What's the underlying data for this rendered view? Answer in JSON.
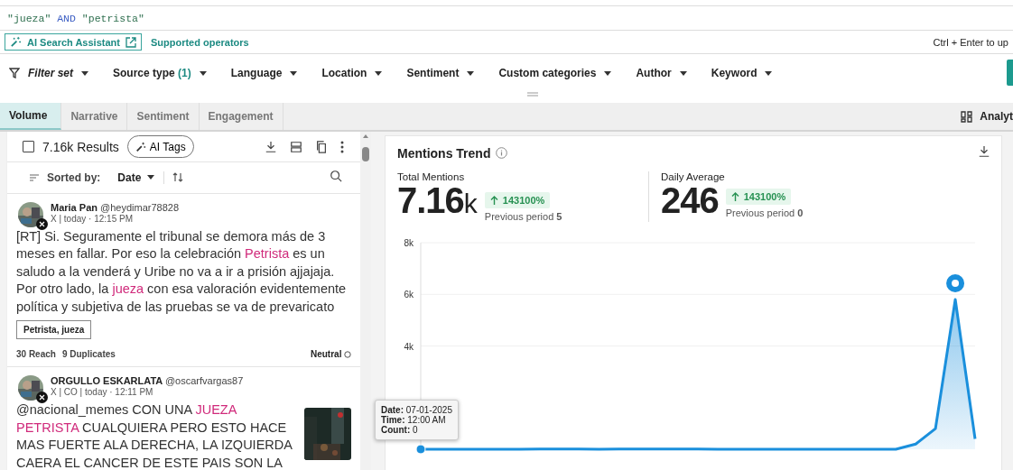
{
  "query": [
    {
      "text": "\"jueza\"",
      "kind": "term"
    },
    {
      "text": "AND",
      "kind": "operator"
    },
    {
      "text": "\"petrista\"",
      "kind": "term"
    }
  ],
  "assistant_button": "AI Search Assistant",
  "operators_link": "Supported operators",
  "shortcut_hint": "Ctrl + Enter to up",
  "filters": [
    {
      "label": "Filter set",
      "kind": "set"
    },
    {
      "label": "Source type",
      "count": "(1)",
      "kind": "filter"
    },
    {
      "label": "Language",
      "kind": "filter"
    },
    {
      "label": "Location",
      "kind": "filter"
    },
    {
      "label": "Sentiment",
      "kind": "filter"
    },
    {
      "label": "Custom categories",
      "kind": "filter"
    },
    {
      "label": "Author",
      "kind": "filter"
    },
    {
      "label": "Keyword",
      "kind": "filter"
    }
  ],
  "tabs": [
    {
      "label": "Volume",
      "selected": true
    },
    {
      "label": "Narrative",
      "selected": false
    },
    {
      "label": "Sentiment",
      "selected": false
    },
    {
      "label": "Engagement",
      "selected": false
    }
  ],
  "analytics_label": "Analyt",
  "results": {
    "count": "7.16k Results",
    "checked": false,
    "ai_tags": "AI Tags",
    "sort_label": "Sorted by:",
    "sort_value": "Date"
  },
  "posts": [
    {
      "name": "Maria Pan",
      "handle": "@heydimar78828",
      "meta": "X | today · 12:15 PM",
      "text": [
        {
          "text": "[RT] Si. Seguramente el tribunal se demora más de 3 meses en fallar. Por eso la celebración ",
          "highlight": false
        },
        {
          "text": "Petrista",
          "highlight": true
        },
        {
          "text": " es un saludo a la venderá y Uribe no va a ir a prisión ajjajaja. Por otro lado, la ",
          "highlight": false
        },
        {
          "text": "jueza",
          "highlight": true
        },
        {
          "text": " con esa valoración evidentemente política y subjetiva de las pruebas se va de prevaricato",
          "highlight": false
        }
      ],
      "tag": "Petrista, jueza",
      "reach": "30 Reach",
      "duplicates": "9 Duplicates",
      "sentiment": "Neutral"
    },
    {
      "name": "ORGULLO ESKARLATA",
      "handle": "@oscarfvargas87",
      "meta": "X | CO | today · 12:11 PM",
      "text": [
        {
          "text": "@nacional_memes CON UNA ",
          "highlight": false
        },
        {
          "text": "JUEZA PETRISTA",
          "highlight": true
        },
        {
          "text": " CUALQUIERA PERO ESTO HACE MAS FUERTE ALA DERECHA, LA IZQUIERDA CAERA EL CANCER DE ESTE PAIS SON LA",
          "highlight": false
        }
      ],
      "thumbnail": {
        "kind": "picture"
      }
    }
  ],
  "trend": {
    "title": "Mentions Trend",
    "stats": [
      {
        "label": "Total Mentions",
        "value": "7.16",
        "unit": "k",
        "change": "143100%",
        "previous": "Previous period **5**"
      },
      {
        "label": "Daily Average",
        "value": "246",
        "change": "143100%",
        "previous": "Previous period **0**"
      }
    ],
    "chart_data": {
      "type": "area",
      "series": [
        {
          "color": "#1a8fdc",
          "values": [
            0,
            0,
            0,
            0,
            0,
            0,
            10,
            10,
            10,
            0,
            10,
            10,
            10,
            10,
            10,
            0,
            0,
            0,
            0,
            0,
            0,
            0,
            0,
            0,
            0,
            200,
            800,
            5800,
            400
          ]
        }
      ],
      "ylim": [
        0,
        8000
      ],
      "yticks": [
        {
          "value": 4000,
          "label": "4k"
        },
        {
          "value": 6000,
          "label": "6k"
        },
        {
          "value": 8000,
          "label": "8k"
        }
      ]
    },
    "tooltip": [
      {
        "label": "Date:",
        "value": "07-01-2025"
      },
      {
        "label": "Time:",
        "value": "12:00 AM"
      },
      {
        "label": "Count:",
        "value": "0"
      }
    ]
  }
}
